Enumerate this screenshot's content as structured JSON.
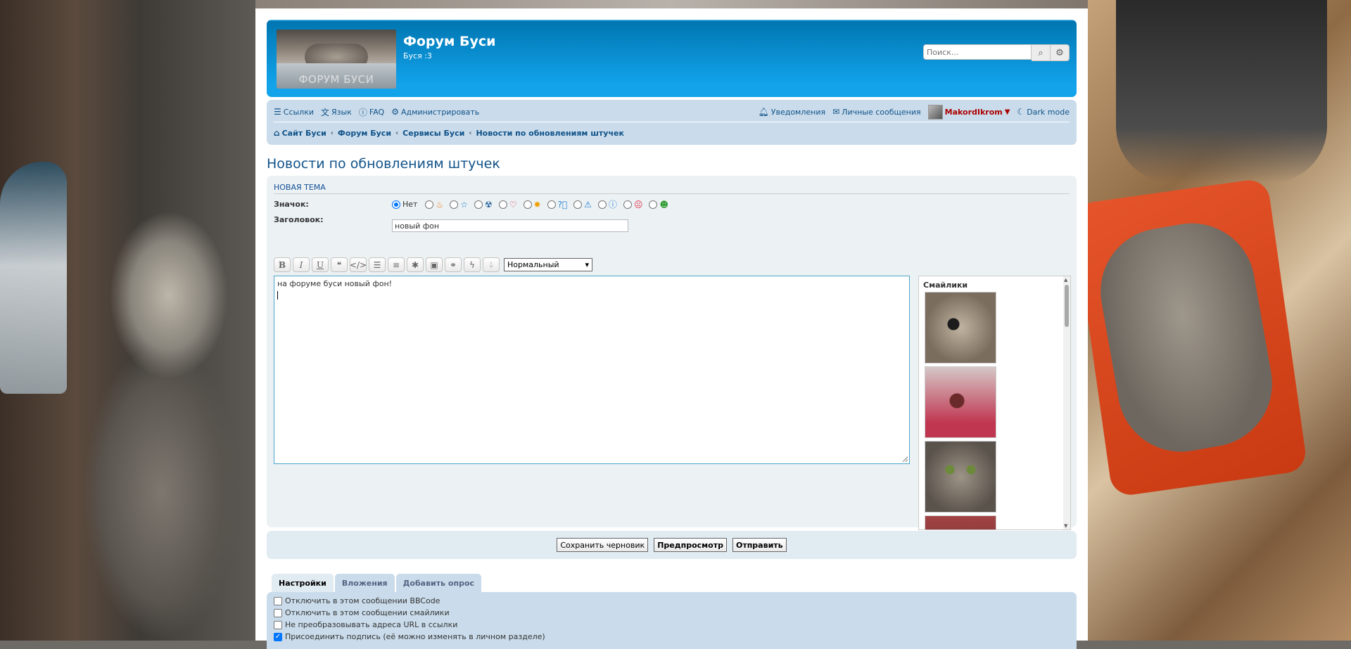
{
  "site": {
    "logo_text": "ФОРУМ БУСИ",
    "title": "Форум Буси",
    "description": "Буся :3",
    "search_placeholder": "Поиск..."
  },
  "nav": {
    "left": [
      {
        "icon": "menu-icon",
        "label": "Ссылки"
      },
      {
        "icon": "language-icon",
        "label": "Язык"
      },
      {
        "icon": "help-icon",
        "label": "FAQ"
      },
      {
        "icon": "gears-icon",
        "label": "Администрировать"
      }
    ],
    "right": {
      "notifications": "Уведомления",
      "messages": "Личные сообщения",
      "username": "MakordIkrom",
      "dark_mode": "Dark mode"
    },
    "breadcrumbs": [
      "Сайт Буси",
      "Форум Буси",
      "Сервисы Буси",
      "Новости по обновлениям штучек"
    ]
  },
  "page_title": "Новости по обновлениям штучек",
  "form": {
    "legend": "Новая тема",
    "icon_label": "Значок:",
    "icon_none": "Нет",
    "subject_label": "Заголовок:",
    "subject_value": "новый фон",
    "font_size_selected": "Нормальный",
    "message": "на форуме буси новый фон!",
    "smilies_title": "Смайлики"
  },
  "buttons": {
    "save_draft": "Сохранить черновик",
    "preview": "Предпросмотр",
    "submit": "Отправить"
  },
  "tabs": [
    "Настройки",
    "Вложения",
    "Добавить опрос"
  ],
  "options": [
    {
      "label": "Отключить в этом сообщении BBCode",
      "checked": false
    },
    {
      "label": "Отключить в этом сообщении смайлики",
      "checked": false
    },
    {
      "label": "Не преобразовывать адреса URL в ссылки",
      "checked": false
    },
    {
      "label": "Присоединить подпись (её можно изменять в личном разделе)",
      "checked": true
    }
  ],
  "colors": {
    "header_blue": "#12a3eb",
    "nav_bg": "#cadceb",
    "link": "#105289",
    "username": "#aa0000"
  }
}
